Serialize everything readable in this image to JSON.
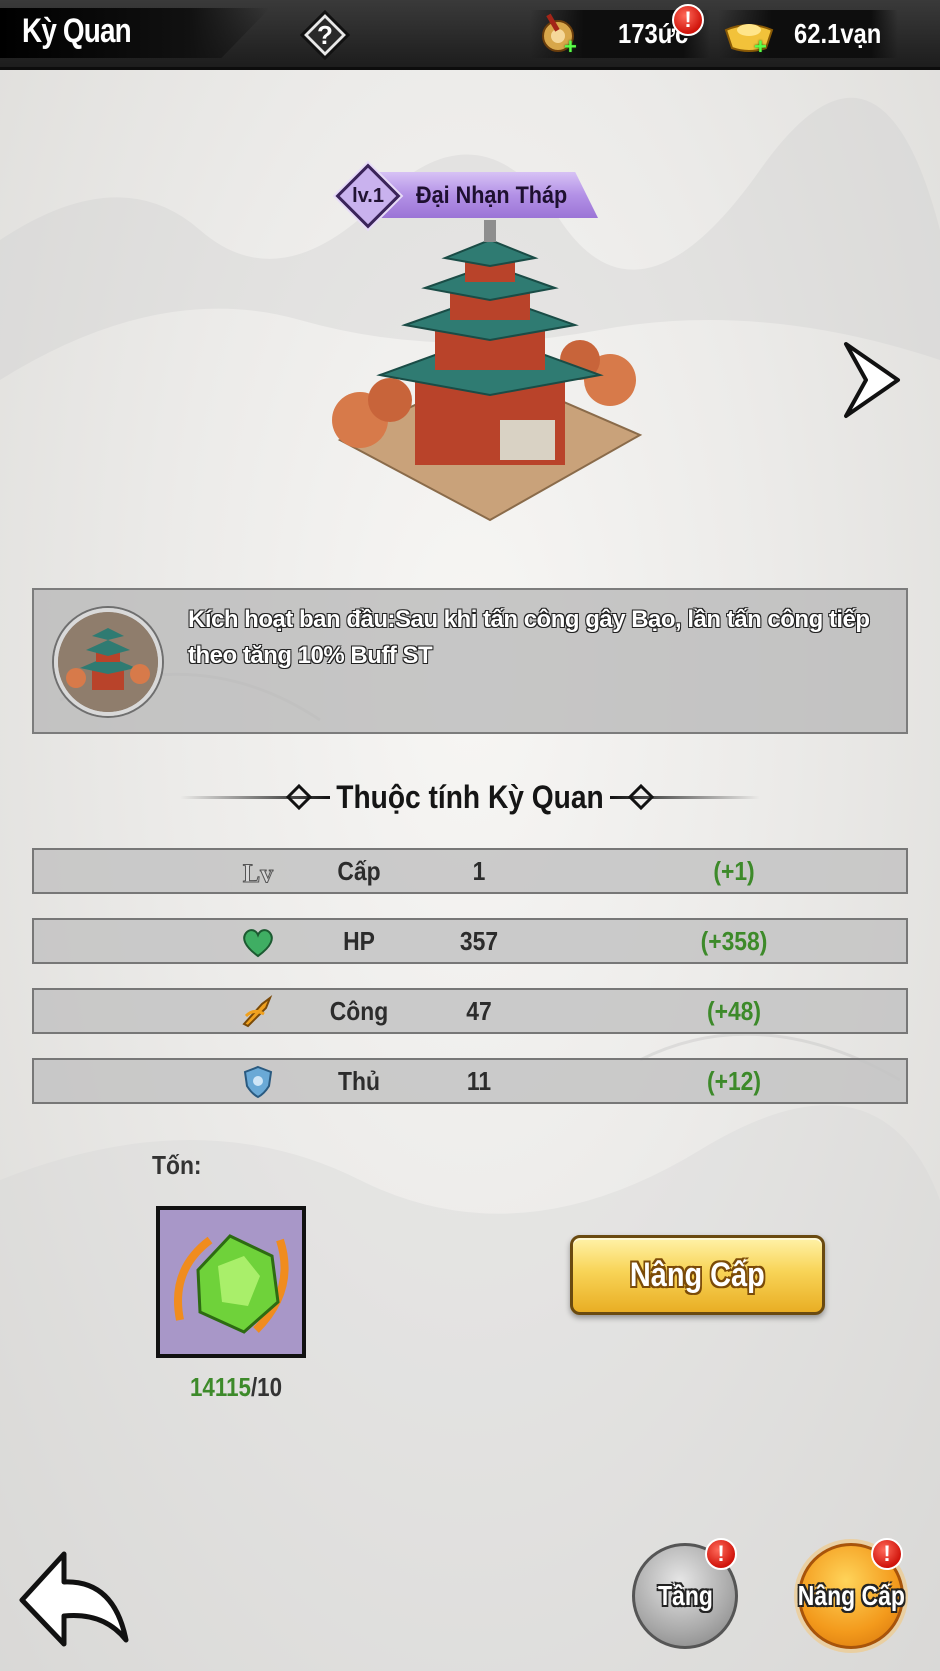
{
  "header": {
    "title": "Kỳ Quan",
    "help_icon": "question-icon",
    "resources": [
      {
        "name": "scroll-currency",
        "value": "173ức",
        "has_alert": true
      },
      {
        "name": "gold-ingot",
        "value": "62.1vạn",
        "has_alert": false
      }
    ],
    "alert_mark": "!"
  },
  "building": {
    "level": "lv.1",
    "name": "Đại Nhạn Tháp"
  },
  "description": {
    "text": "Kích hoạt ban đầu:Sau khi tấn công gây Bạo, lần tấn công tiếp theo tăng 10% Buff ST"
  },
  "attributes": {
    "section_title": "Thuộc tính Kỳ Quan",
    "rows": [
      {
        "icon": "level-icon",
        "label": "Cấp",
        "value": "1",
        "bonus": "(+1)"
      },
      {
        "icon": "heart-icon",
        "label": "HP",
        "value": "357",
        "bonus": "(+358)"
      },
      {
        "icon": "attack-icon",
        "label": "Công",
        "value": "47",
        "bonus": "(+48)"
      },
      {
        "icon": "shield-icon",
        "label": "Thủ",
        "value": "11",
        "bonus": "(+12)"
      }
    ]
  },
  "cost": {
    "label": "Tốn:",
    "have": "14115",
    "need": "/10",
    "item_icon": "green-gem-icon"
  },
  "actions": {
    "upgrade_label": "Nâng Cấp",
    "tier_label": "Tầng",
    "upgrade_tab_label": "Nâng Cấp"
  },
  "colors": {
    "bonus_green": "#3d8a2a",
    "button_gold": "#f8d457",
    "ribbon_purple": "#b391e6",
    "alert_red": "#d0140b"
  }
}
